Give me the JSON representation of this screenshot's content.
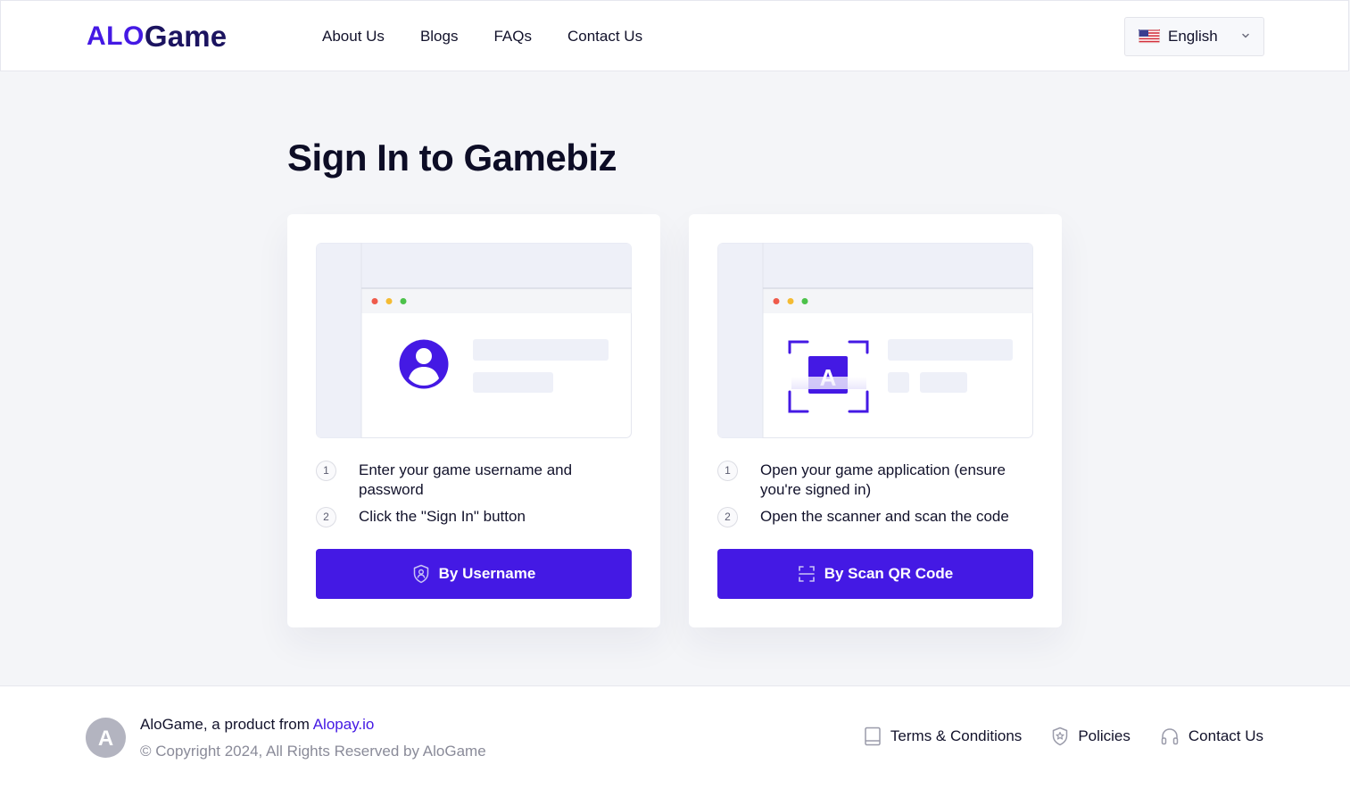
{
  "header": {
    "logo": {
      "part1": "ALO",
      "part2": "Game"
    },
    "nav": [
      {
        "label": "About Us"
      },
      {
        "label": "Blogs"
      },
      {
        "label": "FAQs"
      },
      {
        "label": "Contact Us"
      }
    ],
    "language": {
      "label": "English",
      "flag": "us-flag-icon"
    }
  },
  "main": {
    "title": "Sign In to Gamebiz",
    "cards": [
      {
        "steps": [
          {
            "num": "1",
            "text": "Enter your game username and password"
          },
          {
            "num": "2",
            "text": "Click the \"Sign In\" button"
          }
        ],
        "button": {
          "label": "By Username",
          "icon": "shield-user-icon"
        }
      },
      {
        "illus_badge": "A",
        "steps": [
          {
            "num": "1",
            "text": "Open your game application (ensure you're signed in)"
          },
          {
            "num": "2",
            "text": "Open the scanner and scan the code"
          }
        ],
        "button": {
          "label": "By Scan QR Code",
          "icon": "scan-icon"
        }
      }
    ]
  },
  "footer": {
    "avatar_letter": "A",
    "product_text": "AloGame, a product from",
    "product_link": "Alopay.io",
    "copyright": "© Copyright 2024, All Rights Reserved by AloGame",
    "links": [
      {
        "label": "Terms & Conditions",
        "icon": "document-icon"
      },
      {
        "label": "Policies",
        "icon": "shield-star-icon"
      },
      {
        "label": "Contact Us",
        "icon": "headphones-icon"
      }
    ]
  },
  "colors": {
    "accent": "#4419e4",
    "background": "#f4f5f8",
    "text": "#12122b",
    "muted": "#8a8b99"
  }
}
